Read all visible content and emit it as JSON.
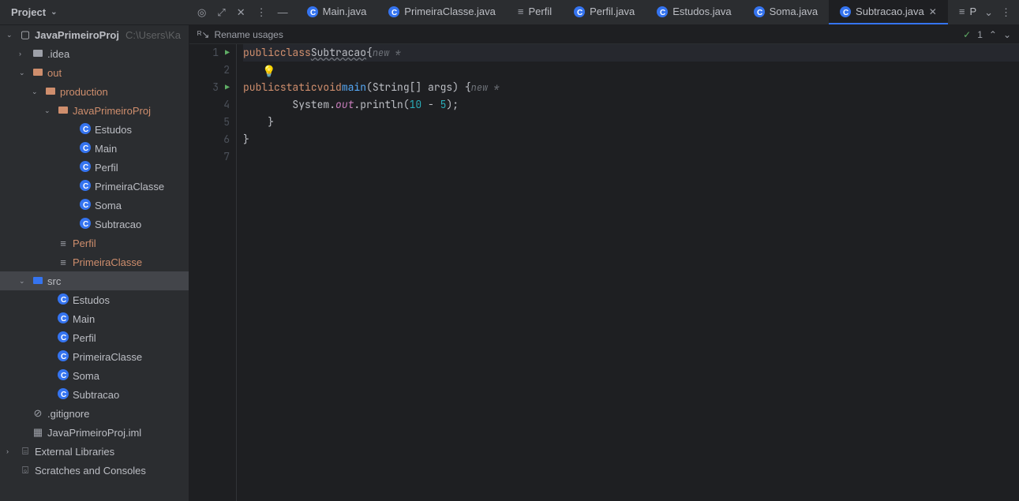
{
  "project_panel": {
    "label": "Project"
  },
  "tabs": [
    {
      "label": "Main.java",
      "type": "class"
    },
    {
      "label": "PrimeiraClasse.java",
      "type": "class"
    },
    {
      "label": "Perfil",
      "type": "text"
    },
    {
      "label": "Perfil.java",
      "type": "class"
    },
    {
      "label": "Estudos.java",
      "type": "class"
    },
    {
      "label": "Soma.java",
      "type": "class"
    },
    {
      "label": "Subtracao.java",
      "type": "class",
      "active": true,
      "closable": true
    },
    {
      "label": "P",
      "type": "text",
      "truncated": true
    }
  ],
  "tree": {
    "root": {
      "label": "JavaPrimeiroProj",
      "path": "C:\\Users\\Ka"
    },
    "idea": ".idea",
    "out": "out",
    "production": "production",
    "proj_inner": "JavaPrimeiroProj",
    "prod_files": [
      "Estudos",
      "Main",
      "Perfil",
      "PrimeiraClasse",
      "Soma",
      "Subtracao"
    ],
    "perfil_file": "Perfil",
    "primeiraclasse_file": "PrimeiraClasse",
    "src": "src",
    "src_files": [
      "Estudos",
      "Main",
      "Perfil",
      "PrimeiraClasse",
      "Soma",
      "Subtracao"
    ],
    "gitignore": ".gitignore",
    "iml": "JavaPrimeiroProj.iml",
    "external": "External Libraries",
    "scratches": "Scratches and Consoles"
  },
  "editor": {
    "rename_hint": "Rename usages",
    "inspection_count": "1",
    "lines": {
      "l1_kw1": "public",
      "l1_kw2": "class",
      "l1_cls": "Subtracao",
      "l1_brace": "{",
      "l1_hint": "new *",
      "l3_kw1": "public",
      "l3_kw2": "static",
      "l3_kw3": "void",
      "l3_fn": "main",
      "l3_args": "(String[] args) {",
      "l3_hint": "new *",
      "l4_pre": "        System.",
      "l4_out": "out",
      "l4_mid": ".println(",
      "l4_n1": "10",
      "l4_op": " - ",
      "l4_n2": "5",
      "l4_end": ");",
      "l5": "    }",
      "l6": "}"
    },
    "gutter_nums": [
      "1",
      "2",
      "3",
      "4",
      "5",
      "6",
      "7"
    ]
  }
}
